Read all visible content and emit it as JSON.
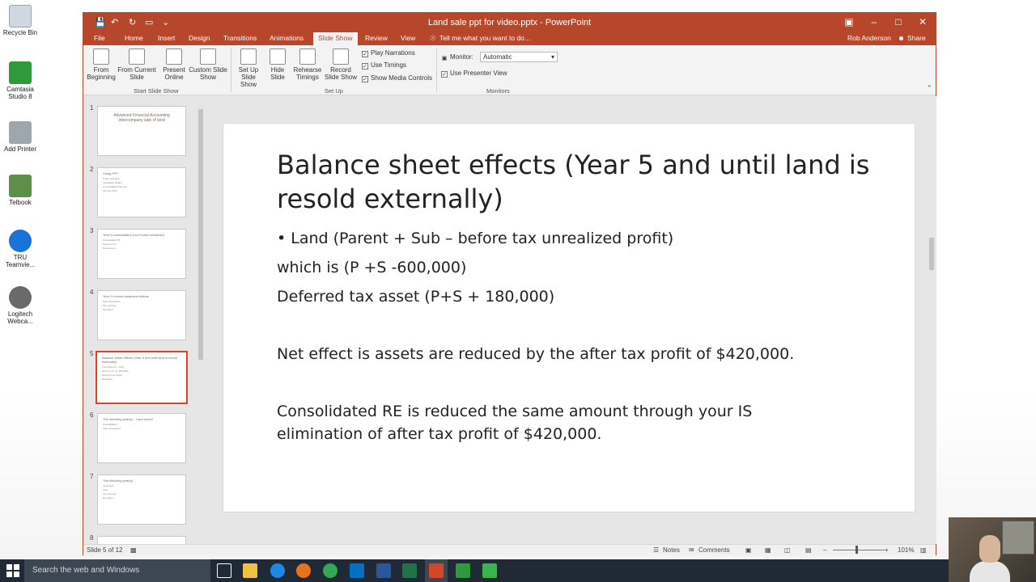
{
  "desktop": {
    "icons": [
      "Recycle Bin",
      "Camtasia Studio 8",
      "Add Printer",
      "Telbook",
      "TRU Teamvie...",
      "Logitech Webca..."
    ]
  },
  "window": {
    "title": "Land sale ppt for video.pptx - PowerPoint",
    "tabs": [
      "File",
      "Home",
      "Insert",
      "Design",
      "Transitions",
      "Animations",
      "Slide Show",
      "Review",
      "View"
    ],
    "tell_me": "Tell me what you want to do...",
    "user": "Rob Anderson",
    "share": "Share"
  },
  "ribbon": {
    "start_group": {
      "label": "Start Slide Show",
      "buttons": [
        "From Beginning",
        "From Current Slide",
        "Present Online",
        "Custom Slide Show"
      ]
    },
    "setup_group": {
      "label": "Set Up",
      "buttons": [
        "Set Up Slide Show",
        "Hide Slide",
        "Rehearse Timings",
        "Record Slide Show"
      ],
      "checks": [
        "Play Narrations",
        "Use Timings",
        "Show Media Controls"
      ]
    },
    "monitors_group": {
      "label": "Monitors",
      "monitor_label": "Monitor:",
      "monitor_value": "Automatic",
      "presenter_view": "Use Presenter View"
    }
  },
  "thumbnails": [
    {
      "num": "1",
      "title": "Advanced Financial Accounting Intercompany sale of land",
      "lines": []
    },
    {
      "num": "2",
      "title": "Using PPT",
      "lines": [
        "P has sold land",
        "Subsidiary dollars",
        "Consolidated amounts",
        "Tax rate 30%"
      ]
    },
    {
      "num": "3",
      "title": "Year 5 consolidation (not IS-elim schedule)",
      "lines": [
        "Consolidated NI",
        "Deferred tax",
        "Net amount"
      ]
    },
    {
      "num": "4",
      "title": "Year 5 income statement effects",
      "lines": [
        "Gain eliminated",
        "Tax expense",
        "Net effect"
      ]
    },
    {
      "num": "5",
      "title": "Balance sheet effects (Year 5 and until land is resold externally)",
      "lines": [
        "Land (Parent + Sub)",
        "which is (P +S -600,000)",
        "Deferred tax asset",
        "Net effect"
      ]
    },
    {
      "num": "6",
      "title": "The following year(s) - Land resold",
      "lines": [
        "Consolidated",
        "Gain recognized"
      ]
    },
    {
      "num": "7",
      "title": "The following year(s)",
      "lines": [
        "Land sold",
        "Gain",
        "Tax expense",
        "Net effect"
      ]
    },
    {
      "num": "8",
      "title": "",
      "lines": []
    }
  ],
  "slide": {
    "heading": "Balance sheet effects (Year 5 and until land is resold externally)",
    "bullet": "• Land (Parent + Sub – before tax unrealized profit)",
    "line2": "which is (P +S -600,000)",
    "line3": "Deferred tax asset (P+S + 180,000)",
    "line4": "Net effect is assets are reduced by the after tax profit of $420,000.",
    "line5a": "Consolidated RE is reduced the same amount through your IS",
    "line5b": "elimination of after tax profit of $420,000."
  },
  "statusbar": {
    "slide_info": "Slide 5 of 12",
    "notes": "Notes",
    "comments": "Comments",
    "zoom": "101%"
  },
  "taskbar": {
    "search_placeholder": "Search the web and Windows"
  },
  "colors": {
    "ppt_accent": "#b7472a",
    "selected_thumb": "#d24726",
    "taskbar": "#1f2a36"
  }
}
